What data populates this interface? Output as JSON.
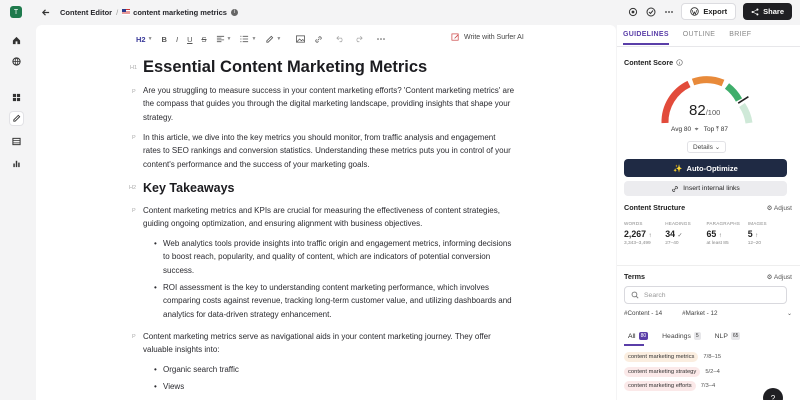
{
  "rail": {
    "avatar_letter": "T",
    "icons": [
      "home-icon",
      "globe-icon",
      "grid-icon",
      "edit-icon",
      "table-icon",
      "chart-icon"
    ]
  },
  "topbar": {
    "app_title": "Content Editor",
    "separator": "/",
    "document_title": "content marketing metrics",
    "export_label": "Export",
    "share_label": "Share"
  },
  "toolbar": {
    "heading_label": "H2",
    "bold": "B",
    "italic": "I",
    "underline": "U",
    "strike": "S",
    "write_ai_label": "Write with Surfer AI"
  },
  "document": {
    "h1_tag": "H1",
    "h2_tag": "H2",
    "p_tag": "P",
    "title": "Essential Content Marketing Metrics",
    "intro": "Are you struggling to measure success in your content marketing efforts? 'Content marketing metrics' are the compass that guides you through the digital marketing landscape, providing insights that shape your strategy.",
    "p2": "In this article, we dive into the key metrics you should monitor, from traffic analysis and engagement rates to SEO rankings and conversion statistics. Understanding these metrics puts you in control of your content's performance and the success of your marketing goals.",
    "h2": "Key Takeaways",
    "p3": "Content marketing metrics and KPIs are crucial for measuring the effectiveness of content strategies, guiding ongoing optimization, and ensuring alignment with business objectives.",
    "b1": "Web analytics tools provide insights into traffic origin and engagement metrics, informing decisions to boost reach, popularity, and quality of content, which are indicators of potential conversion success.",
    "b2": "ROI assessment is the key to understanding content marketing performance, which involves comparing costs against revenue, tracking long-term customer value, and utilizing dashboards and analytics for data-driven strategy enhancement.",
    "p4": "Content marketing metrics serve as navigational aids in your content marketing journey. They offer valuable insights into:",
    "b3": "Organic search traffic",
    "b4": "Views"
  },
  "panel": {
    "tabs": [
      "GUIDELINES",
      "OUTLINE",
      "BRIEF"
    ],
    "content_score_label": "Content Score",
    "score": "82",
    "score_max": "/100",
    "avg_label": "Avg",
    "avg_value": "80",
    "top_label": "Top",
    "top_value": "87",
    "score_fraction": 0.82,
    "details_label": "Details",
    "auto_optimize_label": "Auto-Optimize",
    "insert_links_label": "Insert internal links",
    "structure_title": "Content Structure",
    "adjust_label": "Adjust",
    "stats": [
      {
        "label": "WORDS",
        "value": "2,267",
        "mark": "↑",
        "range": "3,343–3,499"
      },
      {
        "label": "HEADINGS",
        "value": "34",
        "mark": "✓",
        "range": "27–40"
      },
      {
        "label": "PARAGRAPHS",
        "value": "65",
        "mark": "↑",
        "range": "at least 85"
      },
      {
        "label": "IMAGES",
        "value": "5",
        "mark": "↑",
        "range": "12–20"
      }
    ],
    "terms_title": "Terms",
    "search_placeholder": "Search",
    "filter1": "#Content - 14",
    "filter2": "#Market - 12",
    "chips": [
      {
        "label": "All",
        "count": "80"
      },
      {
        "label": "Headings",
        "count": "5"
      },
      {
        "label": "NLP",
        "count": "65"
      }
    ],
    "terms": [
      {
        "name": "content marketing metrics",
        "ratio": "7/8–15"
      },
      {
        "name": "content marketing strategy",
        "ratio": "5/2–4"
      },
      {
        "name": "content marketing efforts",
        "ratio": "7/3–4"
      }
    ]
  },
  "colors": {
    "accent": "#5a3ea8",
    "gauge_red": "#e24b3b",
    "gauge_orange": "#e88a3a",
    "gauge_green": "#3fae6b",
    "dark_button": "#1f2a44"
  }
}
